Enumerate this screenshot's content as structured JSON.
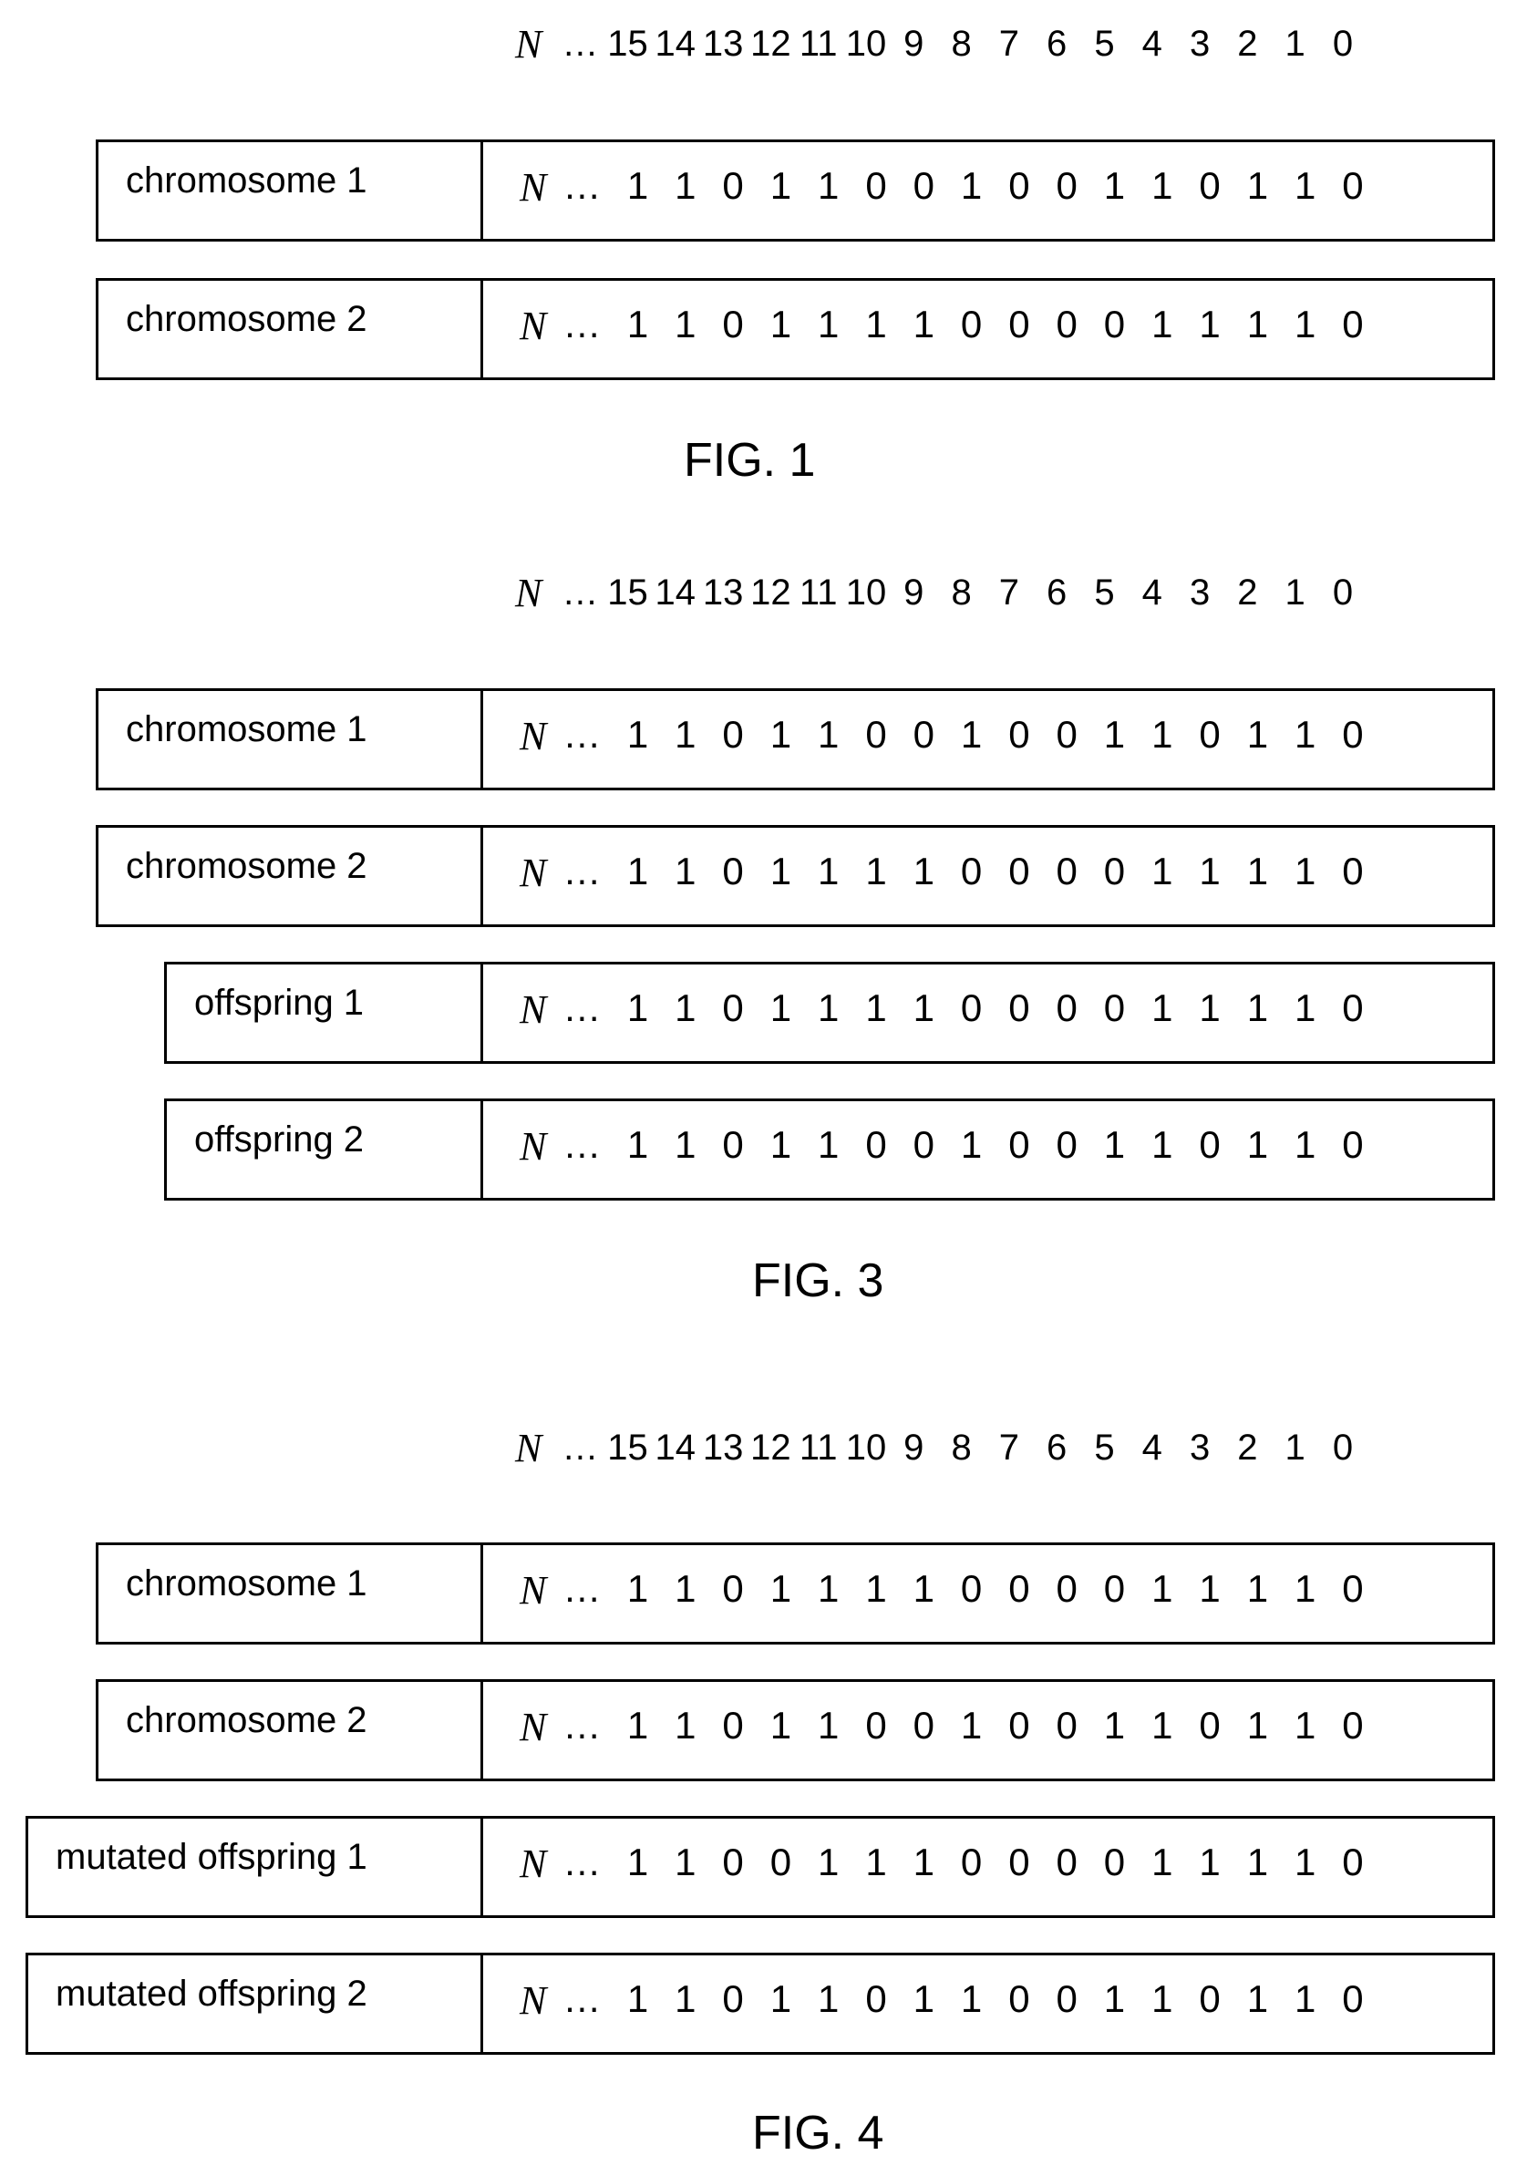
{
  "index_header": {
    "n_symbol": "N",
    "ellipsis": "…",
    "indices": [
      "15",
      "14",
      "13",
      "12",
      "11",
      "10",
      "9",
      "8",
      "7",
      "6",
      "5",
      "4",
      "3",
      "2",
      "1",
      "0"
    ]
  },
  "figures": [
    {
      "caption": "FIG. 1",
      "rows": [
        {
          "label": "chromosome 1",
          "bits": [
            "1",
            "1",
            "0",
            "1",
            "1",
            "0",
            "0",
            "1",
            "0",
            "0",
            "1",
            "1",
            "0",
            "1",
            "1",
            "0"
          ]
        },
        {
          "label": "chromosome 2",
          "bits": [
            "1",
            "1",
            "0",
            "1",
            "1",
            "1",
            "1",
            "0",
            "0",
            "0",
            "0",
            "1",
            "1",
            "1",
            "1",
            "0"
          ]
        }
      ]
    },
    {
      "caption": "FIG. 3",
      "rows": [
        {
          "label": "chromosome 1",
          "bits": [
            "1",
            "1",
            "0",
            "1",
            "1",
            "0",
            "0",
            "1",
            "0",
            "0",
            "1",
            "1",
            "0",
            "1",
            "1",
            "0"
          ]
        },
        {
          "label": "chromosome 2",
          "bits": [
            "1",
            "1",
            "0",
            "1",
            "1",
            "1",
            "1",
            "0",
            "0",
            "0",
            "0",
            "1",
            "1",
            "1",
            "1",
            "0"
          ]
        },
        {
          "label": "offspring 1",
          "bits": [
            "1",
            "1",
            "0",
            "1",
            "1",
            "1",
            "1",
            "0",
            "0",
            "0",
            "0",
            "1",
            "1",
            "1",
            "1",
            "0"
          ]
        },
        {
          "label": "offspring 2",
          "bits": [
            "1",
            "1",
            "0",
            "1",
            "1",
            "0",
            "0",
            "1",
            "0",
            "0",
            "1",
            "1",
            "0",
            "1",
            "1",
            "0"
          ]
        }
      ]
    },
    {
      "caption": "FIG. 4",
      "rows": [
        {
          "label": "chromosome 1",
          "bits": [
            "1",
            "1",
            "0",
            "1",
            "1",
            "1",
            "1",
            "0",
            "0",
            "0",
            "0",
            "1",
            "1",
            "1",
            "1",
            "0"
          ]
        },
        {
          "label": "chromosome 2",
          "bits": [
            "1",
            "1",
            "0",
            "1",
            "1",
            "0",
            "0",
            "1",
            "0",
            "0",
            "1",
            "1",
            "0",
            "1",
            "1",
            "0"
          ]
        },
        {
          "label": "mutated offspring 1",
          "bits": [
            "1",
            "1",
            "0",
            "0",
            "1",
            "1",
            "1",
            "0",
            "0",
            "0",
            "0",
            "1",
            "1",
            "1",
            "1",
            "0"
          ]
        },
        {
          "label": "mutated offspring 2",
          "bits": [
            "1",
            "1",
            "0",
            "1",
            "1",
            "0",
            "1",
            "1",
            "0",
            "0",
            "1",
            "1",
            "0",
            "1",
            "1",
            "0"
          ]
        }
      ]
    }
  ]
}
